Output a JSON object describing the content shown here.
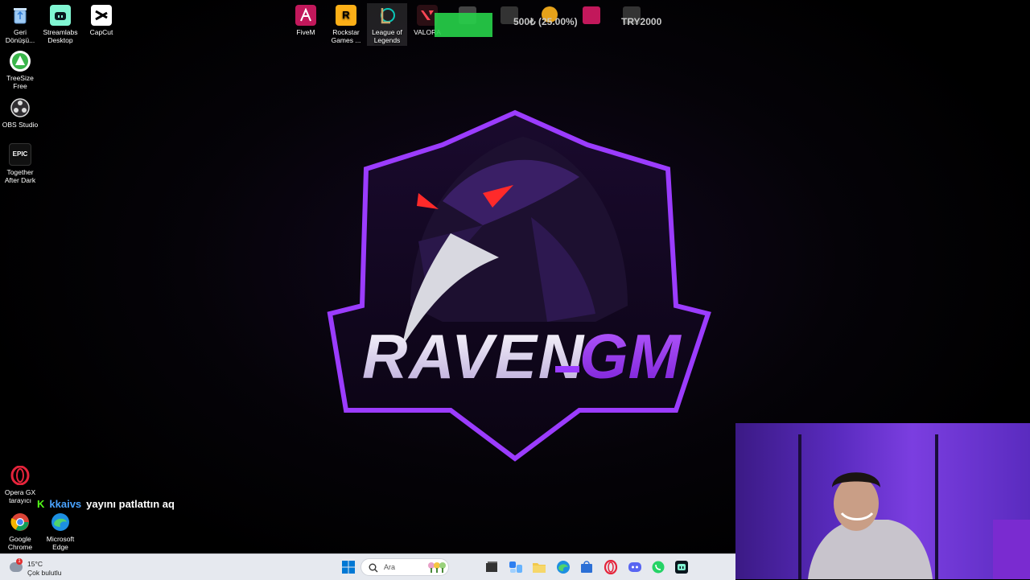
{
  "desktop": {
    "left_icons": [
      {
        "label": "Geri Dönüşü...",
        "icon": "recycle-bin-icon"
      },
      {
        "label": "Streamlabs Desktop",
        "icon": "streamlabs-icon"
      },
      {
        "label": "CapCut",
        "icon": "capcut-icon"
      },
      {
        "label": "TreeSize Free",
        "icon": "treesize-icon"
      },
      {
        "label": "OBS Studio",
        "icon": "obs-icon"
      },
      {
        "label": "Together After Dark",
        "icon": "epic-games-icon",
        "glyph": "EPIC"
      },
      {
        "label": "Opera GX tarayıcı",
        "icon": "opera-gx-icon"
      },
      {
        "label": "Google Chrome",
        "icon": "chrome-icon"
      },
      {
        "label": "Microsoft Edge",
        "icon": "edge-icon"
      }
    ],
    "top_icons": [
      {
        "label": "FiveM",
        "icon": "fivem-icon"
      },
      {
        "label": "Rockstar Games ...",
        "icon": "rockstar-icon",
        "glyph": "R"
      },
      {
        "label": "League of Legends",
        "icon": "league-icon"
      },
      {
        "label": "VALORA",
        "icon": "valorant-icon"
      }
    ]
  },
  "stream_overlay": {
    "goal_text": "500₺ (25.00%)",
    "goal_progress": 0.25,
    "currency_text": "TRY2000"
  },
  "wallpaper": {
    "logo_text_1": "RAVEN",
    "logo_text_2": "GM",
    "accent": "#8a2be2"
  },
  "chat": {
    "username": "kkaivs",
    "message": "yayını patlattın aq"
  },
  "taskbar": {
    "weather_temp": "15°C",
    "weather_desc": "Çok bulutlu",
    "weather_alert": "1",
    "search_placeholder": "Ara"
  }
}
